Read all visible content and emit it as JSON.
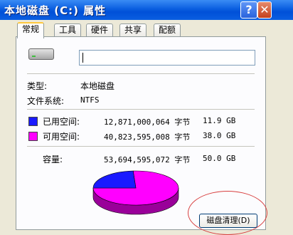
{
  "window": {
    "title": "本地磁盘 (C:) 属性",
    "help_symbol": "?",
    "close_symbol": "✕"
  },
  "tabs": [
    {
      "label": "常规",
      "active": true
    },
    {
      "label": "工具",
      "active": false
    },
    {
      "label": "硬件",
      "active": false
    },
    {
      "label": "共享",
      "active": false
    },
    {
      "label": "配额",
      "active": false
    }
  ],
  "general": {
    "icon": "hard-drive-icon",
    "name_value": "",
    "type_label": "类型:",
    "type_value": "本地磁盘",
    "fs_label": "文件系统:",
    "fs_value": "NTFS",
    "used": {
      "label": "已用空间:",
      "bytes": "12,871,000,064 字节",
      "size": "11.9 GB",
      "color": "#1a1aff"
    },
    "free": {
      "label": "可用空间:",
      "bytes": "40,823,595,008 字节",
      "size": "38.0 GB",
      "color": "#ff00ff"
    },
    "capacity": {
      "label": "容量:",
      "bytes": "53,694,595,072 字节",
      "size": "50.0 GB"
    },
    "used_fraction": 0.24,
    "cleanup_button": "磁盘清理(D)"
  }
}
